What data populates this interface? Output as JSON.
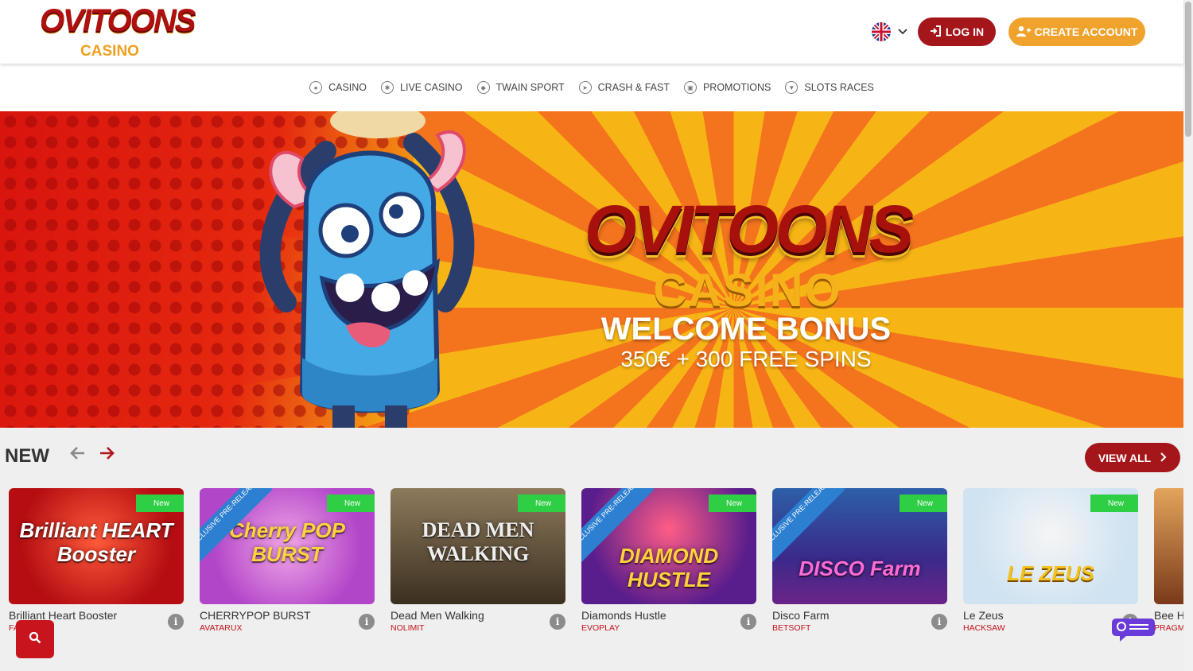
{
  "header": {
    "logo_main": "OVITOONS",
    "logo_sub": "CASINO",
    "login_label": "LOG IN",
    "create_label": "CREATE ACCOUNT"
  },
  "nav": [
    {
      "label": "CASINO",
      "icon": "casino-chip-icon"
    },
    {
      "label": "LIVE CASINO",
      "icon": "live-casino-icon"
    },
    {
      "label": "TWAIN SPORT",
      "icon": "sport-ball-icon"
    },
    {
      "label": "CRASH & FAST",
      "icon": "rocket-icon"
    },
    {
      "label": "PROMOTIONS",
      "icon": "gift-icon"
    },
    {
      "label": "SLOTS RACES",
      "icon": "trophy-icon"
    }
  ],
  "banner": {
    "brand": "OVITOONS",
    "brand_sub": "CASINO",
    "bonus_title": "WELCOME BONUS",
    "bonus_sub": "350€ + 300 FREE SPINS"
  },
  "section": {
    "title": "NEW",
    "view_all": "VIEW ALL"
  },
  "games": [
    {
      "title": "Brilliant Heart Booster",
      "provider": "FA",
      "badge": "New",
      "thumb_text": "Brilliant HEART Booster",
      "bg": "#b50d12",
      "exclusive": false
    },
    {
      "title": "CHERRYPOP BURST",
      "provider": "AVATARUX",
      "badge": "New",
      "thumb_text": "Cherry POP BURST",
      "bg": "#b246c9",
      "exclusive": true
    },
    {
      "title": "Dead Men Walking",
      "provider": "NOLIMIT",
      "badge": "New",
      "thumb_text": "DEAD MEN WALKING",
      "bg": "#5b4a34",
      "exclusive": false
    },
    {
      "title": "Diamonds Hustle",
      "provider": "EVOPLAY",
      "badge": "New",
      "thumb_text": "DIAMOND HUSTLE",
      "bg": "#5a1d8c",
      "exclusive": true
    },
    {
      "title": "Disco Farm",
      "provider": "BETSOFT",
      "badge": "New",
      "thumb_text": "DISCO Farm",
      "bg": "#3a2a8a",
      "exclusive": true
    },
    {
      "title": "Le Zeus",
      "provider": "HACKSAW",
      "badge": "New",
      "thumb_text": "LE ZEUS",
      "bg": "#cfe3f2",
      "exclusive": false
    },
    {
      "title": "Bee H",
      "provider": "PRAGM",
      "badge": "",
      "thumb_text": "",
      "bg": "#b0603a",
      "exclusive": false
    }
  ],
  "ribbon_text": "EXCLUSIVE PRE-RELEASE",
  "colors": {
    "primary": "#a4161a",
    "accent": "#f0a32c",
    "new_badge": "#2fcf45",
    "ribbon": "#2d7fd1"
  }
}
